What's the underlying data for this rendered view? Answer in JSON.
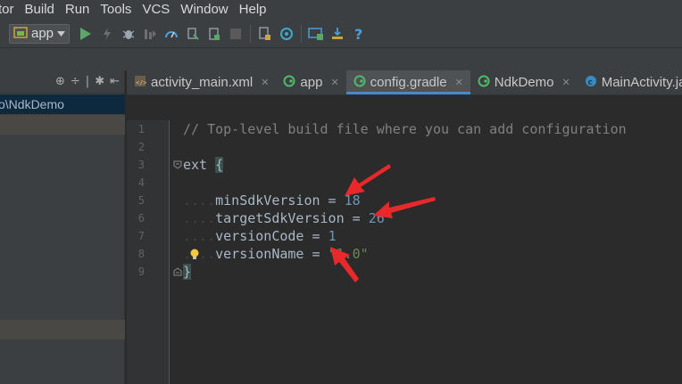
{
  "menu": {
    "items": [
      "tor",
      "Build",
      "Run",
      "Tools",
      "VCS",
      "Window",
      "Help"
    ]
  },
  "toolbar": {
    "config_label": "app"
  },
  "project_panel": {
    "path": "o\\NdkDemo"
  },
  "tabs": [
    {
      "label": "activity_main.xml",
      "icon": "xml-file-icon",
      "active": false,
      "closable": true
    },
    {
      "label": "app",
      "icon": "gradle-icon",
      "active": false,
      "closable": true
    },
    {
      "label": "config.gradle",
      "icon": "gradle-icon",
      "active": true,
      "closable": true
    },
    {
      "label": "NdkDemo",
      "icon": "gradle-icon",
      "active": false,
      "closable": true
    },
    {
      "label": "MainActivity.ja",
      "icon": "class-icon",
      "active": false,
      "closable": false
    }
  ],
  "editor": {
    "line_numbers": [
      "1",
      "2",
      "3",
      "4",
      "5",
      "6",
      "7",
      "8",
      "9"
    ],
    "lines": {
      "l1": "// Top-level build file where you can add configuration",
      "l3_kw": "ext ",
      "l3_brace": "{",
      "l5_key": "minSdkVersion = ",
      "l5_val": "18",
      "l6_key": "targetSdkVersion = ",
      "l6_val": "26",
      "l7_key": "versionCode = ",
      "l7_val": "1",
      "l8_key": "versionName = ",
      "l8_val": "\"1.0\"",
      "l9_brace": "}"
    }
  },
  "colors": {
    "accent": "#4a88c7",
    "arrow": "#e8282a",
    "number": "#6897bb",
    "string": "#6a8759",
    "comment": "#808080"
  }
}
